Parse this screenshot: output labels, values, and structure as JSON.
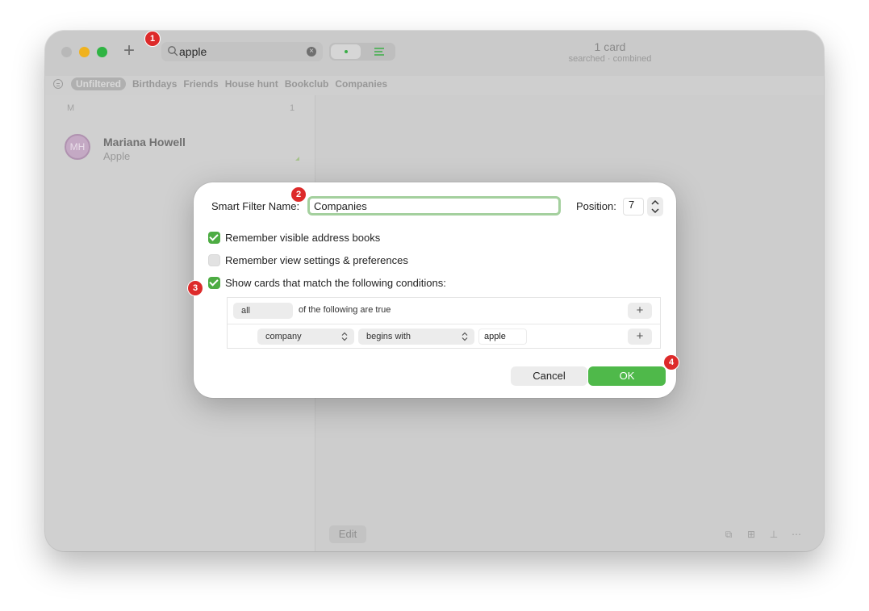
{
  "colors": {
    "accent_green": "#4fb94a",
    "badge_red": "#dd2a2a",
    "focus_ring": "#a4d09e"
  },
  "toolbar": {
    "add_icon": "plus-icon",
    "search_value": "apple",
    "card_count": "1 card",
    "card_subtitle": "searched · combined"
  },
  "filters": [
    "Unfiltered",
    "Birthdays",
    "Friends",
    "House hunt",
    "Bookclub",
    "Companies"
  ],
  "sidebar": {
    "section_letter": "M",
    "section_count": "1",
    "contact": {
      "initials": "MH",
      "name": "Mariana Howell",
      "company": "Apple"
    }
  },
  "bottom_bar": {
    "edit_label": "Edit",
    "icons": [
      "copy-icon",
      "archive-icon",
      "pin-icon",
      "more-icon"
    ]
  },
  "dialog": {
    "name_label": "Smart Filter Name:",
    "name_value": "Companies",
    "position_label": "Position:",
    "position_value": "7",
    "checks": [
      {
        "label": "Remember visible address books",
        "checked": true
      },
      {
        "label": "Remember view settings & preferences",
        "checked": false
      },
      {
        "label": "Show cards that match the following conditions:",
        "checked": true
      }
    ],
    "rules": {
      "match_mode": "all",
      "match_text": "of the following are true",
      "field": "company",
      "operator": "begins with",
      "value": "apple",
      "add_label": "+"
    },
    "cancel_label": "Cancel",
    "ok_label": "OK"
  },
  "badges": [
    "1",
    "2",
    "3",
    "4"
  ]
}
